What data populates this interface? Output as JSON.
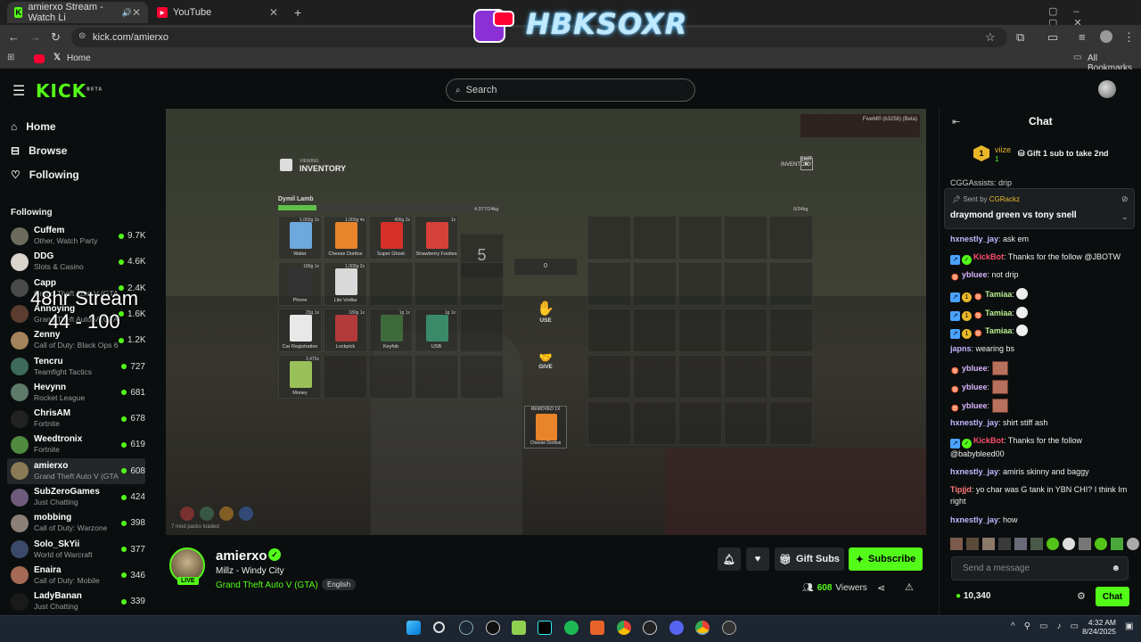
{
  "browser": {
    "tabs": [
      {
        "title": "amierxo Stream - Watch Li",
        "icon": "kick-icon",
        "color": "#53fc18"
      },
      {
        "title": "YouTube",
        "icon": "youtube-icon",
        "color": "#ff0033"
      }
    ],
    "url": "kick.com/amierxo",
    "bookmarks": {
      "home_label": "Home",
      "all_bookmarks_label": "All Bookmarks"
    }
  },
  "watermark": {
    "text": "HBKSOXR"
  },
  "header": {
    "logo": "KICK",
    "logo_beta": "BETA",
    "search_placeholder": "Search"
  },
  "sidebar": {
    "nav": [
      {
        "label": "Home",
        "icon": "home-icon"
      },
      {
        "label": "Browse",
        "icon": "compass-icon"
      },
      {
        "label": "Following",
        "icon": "heart-icon"
      }
    ],
    "following_heading": "Following",
    "channels": [
      {
        "name": "Cuffem",
        "game": "Other, Watch Party",
        "viewers": "9.7K",
        "color": "#6d6a5e"
      },
      {
        "name": "DDG",
        "game": "Slots & Casino",
        "viewers": "4.6K",
        "color": "#d9d4cc"
      },
      {
        "name": "Capp",
        "game": "Grand Theft Auto V (GTA)",
        "viewers": "2.4K",
        "color": "#4a4a4a"
      },
      {
        "name": "Annoying",
        "game": "Grand Theft Auto V (GTA)",
        "viewers": "1.6K",
        "color": "#5a3d2e"
      },
      {
        "name": "Zenny",
        "game": "Call of Duty: Black Ops 6",
        "viewers": "1.2K",
        "color": "#a3835c"
      },
      {
        "name": "Tencru",
        "game": "Teamfight Tactics",
        "viewers": "727",
        "color": "#3d6a5a"
      },
      {
        "name": "Hevynn",
        "game": "Rocket League",
        "viewers": "681",
        "color": "#5d7a6a"
      },
      {
        "name": "ChrisAM",
        "game": "Fortnite",
        "viewers": "678",
        "color": "#222"
      },
      {
        "name": "Weedtronix",
        "game": "Fortnite",
        "viewers": "619",
        "color": "#4f8a3e"
      },
      {
        "name": "amierxo",
        "game": "Grand Theft Auto V (GTA)",
        "viewers": "608",
        "color": "#8a7a55"
      },
      {
        "name": "SubZeroGames",
        "game": "Just Chatting",
        "viewers": "424",
        "color": "#6e5a7a"
      },
      {
        "name": "mobbing",
        "game": "Call of Duty: Warzone",
        "viewers": "398",
        "color": "#8a8077"
      },
      {
        "name": "Solo_SkYii",
        "game": "World of Warcraft",
        "viewers": "377",
        "color": "#3b4a6a"
      },
      {
        "name": "Enaira",
        "game": "Call of Duty: Mobile",
        "viewers": "346",
        "color": "#a56a55"
      },
      {
        "name": "LadyBanan",
        "game": "Just Chatting",
        "viewers": "339",
        "color": "#1a1a1a"
      }
    ],
    "overlay_line1": "48hr Stream",
    "overlay_line2": "44 - 100"
  },
  "video": {
    "hud_top": "FiveM® (b3258) (Beta)",
    "inventory_small": "VIEWING",
    "inventory_title": "INVENTORY",
    "exit_label": "EXIT",
    "exit_sub": "INVENTORY",
    "player_name": "Dymil Lamb",
    "player_weight": "4.077/24kg",
    "ground_weight": "0/24kg",
    "amount": "0",
    "use_label": "USE",
    "give_label": "GIVE",
    "hotbar_number": "5",
    "removed_label": "REMOVED 1X",
    "removed_item": "Cheese Doritos",
    "mod_note": "7 mod packs loaded",
    "slots": [
      {
        "name": "Water",
        "weight": "1,003g 2x",
        "color": "#6fa8dc"
      },
      {
        "name": "Cheese Doritos",
        "weight": "1,000g 4x",
        "color": "#e8852a"
      },
      {
        "name": "Super Ghost",
        "weight": "400g 2x",
        "color": "#d62f2a"
      },
      {
        "name": "Strawberry Footies",
        "weight": "1x",
        "color": "#d6413a"
      },
      {
        "name": "Phone",
        "weight": "180g 1x",
        "color": "#333"
      },
      {
        "name": "Lite Vodka",
        "weight": "1,000g 2x",
        "color": "#d9d9d9"
      },
      {
        "name": "Car Registration",
        "weight": "25g 1x",
        "color": "#e8e8e8"
      },
      {
        "name": "Lockpick",
        "weight": "180g 1x",
        "color": "#b33a3a"
      },
      {
        "name": "Keyfob",
        "weight": "1g 1x",
        "color": "#3e6a3a"
      },
      {
        "name": "USB",
        "weight": "1g 1x",
        "color": "#3a8a6a"
      },
      {
        "name": "Money",
        "weight": "2,475x",
        "color": "#9ac05a"
      }
    ]
  },
  "stream": {
    "name": "amierxo",
    "title": "Millz - Windy City",
    "game": "Grand Theft Auto V (GTA)",
    "language": "English",
    "live_label": "LIVE",
    "viewers": "608",
    "viewers_label": "Viewers",
    "gift_label": "Gift Subs",
    "subscribe_label": "Subscribe"
  },
  "chat": {
    "title": "Chat",
    "gifter_rank": "1",
    "gifter_name": "viize",
    "gifter_count": "1",
    "gift_prompt": "Gift 1 sub to take 2nd",
    "cutoff_msg": "CGGAssists: drip",
    "pinned_label": "Sent by",
    "pinned_user": "CGRackz",
    "pinned_text": "draymond green vs tony snell",
    "messages": [
      {
        "user": "hxnestly_jay",
        "text": ": ask em",
        "color": "#c4b5ff"
      },
      {
        "user": "KickBot",
        "text": ": Thanks for the follow @JBOTW",
        "color": "#ff4d6d"
      },
      {
        "user": "ybluee",
        "text": ": not drip",
        "color": "#d8b4ff"
      },
      {
        "user": "Tamiaa",
        "text": ":",
        "color": "#b8f090"
      },
      {
        "user": "Tamiaa",
        "text": ":",
        "color": "#b8f090"
      },
      {
        "user": "Tamiaa",
        "text": ":",
        "color": "#b8f090"
      },
      {
        "user": "japns",
        "text": ": wearing bs",
        "color": "#c4b5ff"
      },
      {
        "user": "ybluee",
        "text": ":",
        "color": "#d8b4ff"
      },
      {
        "user": "ybluee",
        "text": ":",
        "color": "#d8b4ff"
      },
      {
        "user": "ybluee",
        "text": ":",
        "color": "#d8b4ff"
      },
      {
        "user": "hxnestly_jay",
        "text": ": shirt stiff ash",
        "color": "#c4b5ff"
      },
      {
        "user": "KickBot",
        "text": ": Thanks for the follow @babybleed00",
        "color": "#ff4d6d"
      },
      {
        "user": "hxnestly_jay",
        "text": ": amiris skinny and baggy",
        "color": "#c4b5ff"
      },
      {
        "user": "Tipjjd",
        "text": ": yo char was G tank in YBN CHI? I think Im right",
        "color": "#ff7a7a"
      },
      {
        "user": "hxnestly_jay",
        "text": ": how",
        "color": "#c4b5ff"
      }
    ],
    "input_placeholder": "Send a message",
    "points": "10,340",
    "send_label": "Chat"
  },
  "taskbar": {
    "time": "4:32 AM",
    "date": "8/24/2025"
  }
}
